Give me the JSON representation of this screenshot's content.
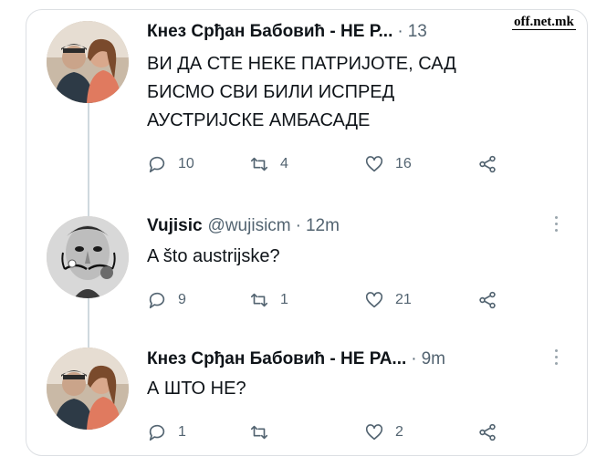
{
  "watermark": "off.net.mk",
  "tweets": [
    {
      "name": "Кнез Срђан Бабовић - НЕ Р...",
      "handle": "",
      "time": "13",
      "text": [
        "ВИ ДА СТЕ НЕКЕ ПАТРИЈОТЕ, САД",
        "БИСМО СВИ БИЛИ ИСПРЕД",
        "АУСТРИЈСКЕ АМБАСАДЕ"
      ],
      "replies": "10",
      "retweets": "4",
      "likes": "16",
      "avatar_icon": "couple-photo-avatar"
    },
    {
      "name": "Vujisic",
      "handle": "@wujisicm",
      "time": "12m",
      "text": [
        "A što austrijske?"
      ],
      "replies": "9",
      "retweets": "1",
      "likes": "21",
      "avatar_icon": "dali-portrait-avatar"
    },
    {
      "name": "Кнез Срђан Бабовић - НЕ РА...",
      "handle": "",
      "time": "9m",
      "text": [
        "А ШТО НЕ?"
      ],
      "replies": "1",
      "retweets": "",
      "likes": "2",
      "avatar_icon": "couple-photo-avatar"
    }
  ],
  "icons": {
    "reply": "reply-icon",
    "retweet": "retweet-icon",
    "like": "heart-icon",
    "share": "share-icon",
    "more": "more-options-icon"
  },
  "colors": {
    "text": "#0f1419",
    "muted": "#536471",
    "thread_line": "#cfd9de",
    "border": "#dcdfe3"
  }
}
